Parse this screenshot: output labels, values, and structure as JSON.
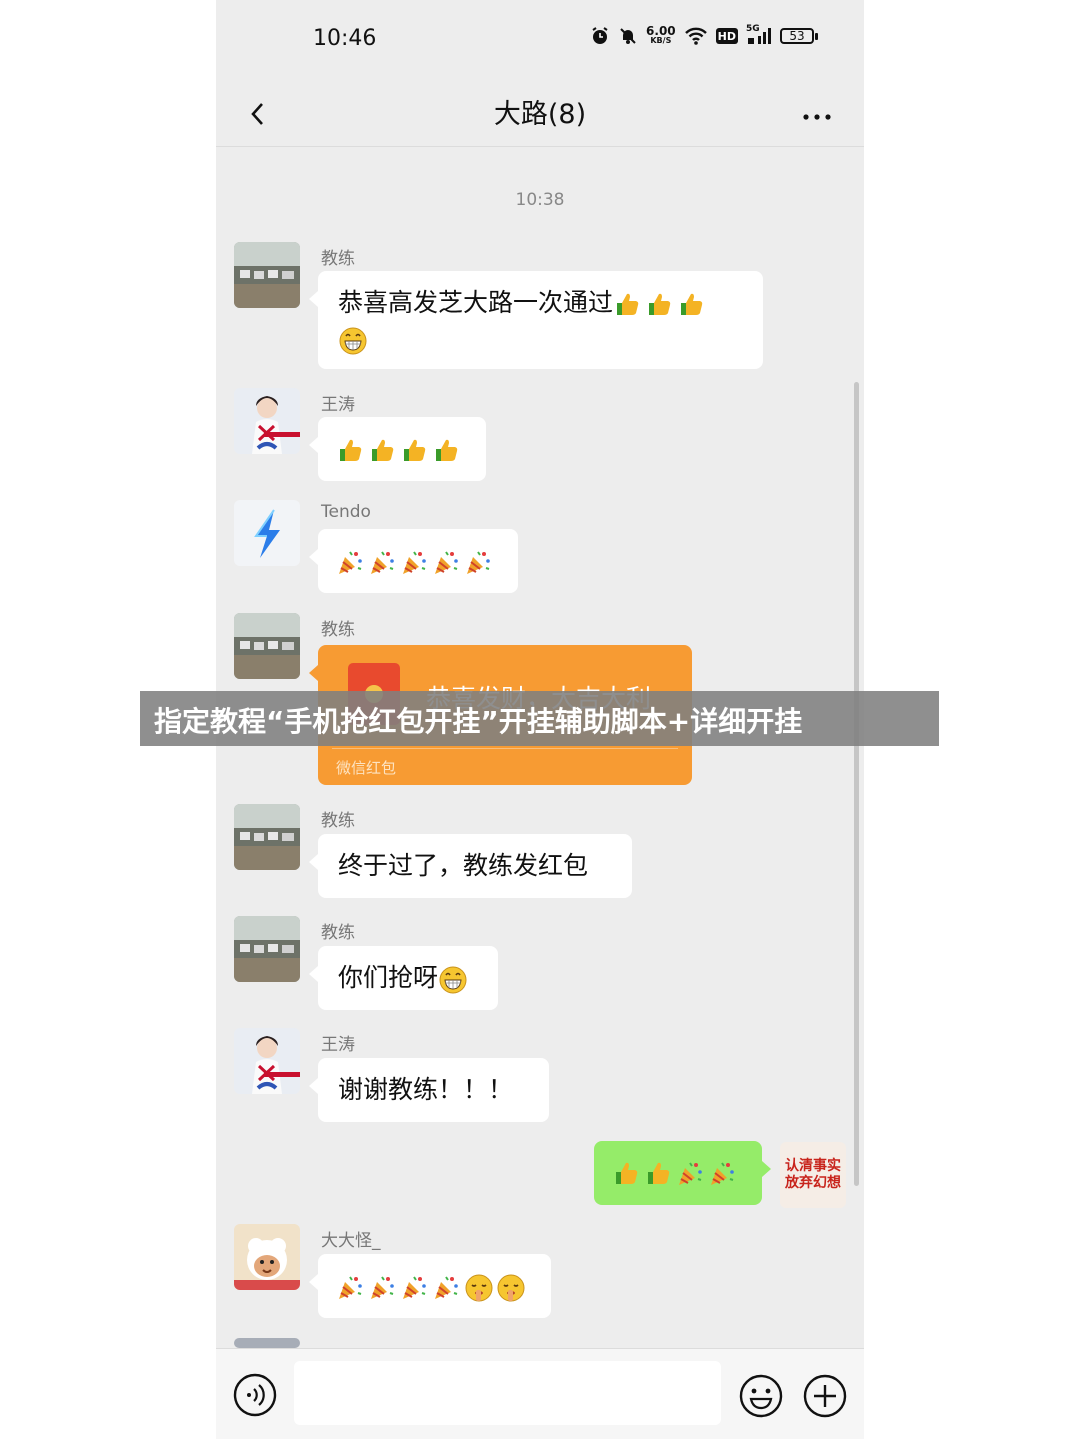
{
  "status_bar": {
    "time": "10:46",
    "net_speed_value": "6.00",
    "net_speed_unit": "KB/S",
    "hd_label": "HD",
    "signal_label": "5G",
    "battery": "53"
  },
  "header": {
    "title": "大路(8)"
  },
  "timestamp": "10:38",
  "messages": [
    {
      "sender": "教练",
      "text": "恭喜高发芝大路一次通过",
      "emojis_line1": [
        "thumbs-up",
        "thumbs-up",
        "thumbs-up"
      ],
      "emojis_line2": [
        "grin"
      ]
    },
    {
      "sender": "王涛",
      "emojis": [
        "thumbs-up",
        "thumbs-up",
        "thumbs-up",
        "thumbs-up"
      ]
    },
    {
      "sender": "Tendo",
      "emojis": [
        "party-popper",
        "party-popper",
        "party-popper",
        "party-popper",
        "party-popper"
      ]
    },
    {
      "sender": "教练",
      "red_packet": {
        "greeting": "恭喜发财，大吉大利",
        "footer": "微信红包"
      }
    },
    {
      "sender": "教练",
      "text": "终于过了，教练发红包"
    },
    {
      "sender": "教练",
      "text": "你们抢呀",
      "emojis": [
        "grin"
      ]
    },
    {
      "sender": "王涛",
      "text": "谢谢教练！！！"
    },
    {
      "sender": "me",
      "emojis": [
        "thumbs-up",
        "thumbs-up",
        "party-popper",
        "party-popper"
      ],
      "avatar_text": [
        "认清事实",
        "放弃幻想"
      ]
    },
    {
      "sender": "大大怪_",
      "emojis": [
        "party-popper",
        "party-popper",
        "party-popper",
        "party-popper",
        "shush",
        "shush"
      ]
    }
  ],
  "overlay_banner": "指定教程“手机抢红包开挂”开挂辅助脚本+详细开挂",
  "colors": {
    "chat_bg": "#ededed",
    "bubble_mine": "#95ec69",
    "red_packet": "#f79b33",
    "banner": "#808080"
  }
}
